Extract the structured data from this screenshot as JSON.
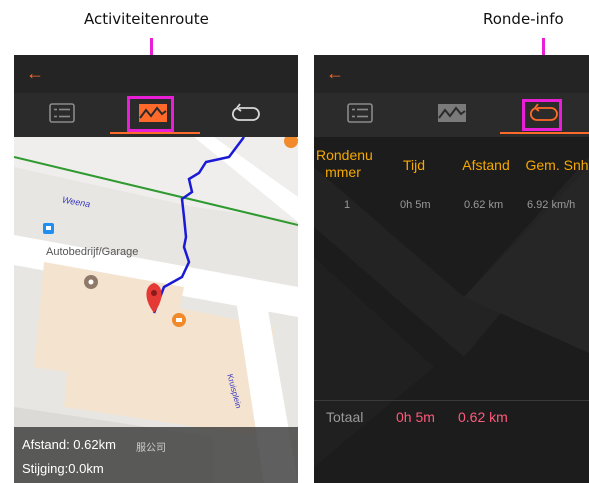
{
  "captions": {
    "left": "Activiteitenroute",
    "right": "Ronde-info"
  },
  "colors": {
    "accent": "#ff6a2a",
    "highlight": "#e81fd6",
    "header_text": "#f5a800",
    "total_text": "#ff5a7a",
    "route": "#1a1ad6"
  },
  "left_screen": {
    "back_icon": "arrow-left-icon",
    "tabs": [
      {
        "icon": "list-icon",
        "active": false
      },
      {
        "icon": "route-map-icon",
        "active": true
      },
      {
        "icon": "lap-loop-icon",
        "active": false
      }
    ],
    "map": {
      "street_label": "Weena",
      "poi_label": "Autobedrijf/Garage",
      "side_street_label": "Kruisplein",
      "overlay_suffix": "服公司",
      "distance": "Afstand: 0.62km",
      "elevation": "Stijging:0.0km"
    }
  },
  "right_screen": {
    "back_icon": "arrow-left-icon",
    "tabs": [
      {
        "icon": "list-icon",
        "active": false
      },
      {
        "icon": "route-map-icon",
        "active": false
      },
      {
        "icon": "lap-loop-icon",
        "active": true
      }
    ],
    "table": {
      "headers": [
        "Rondenu mmer",
        "Tijd",
        "Afstand",
        "Gem. Snh"
      ],
      "rows": [
        [
          "1",
          "0h 5m",
          "0.62 km",
          "6.92 km/h"
        ]
      ],
      "total_label": "Totaal",
      "total_time": "0h 5m",
      "total_distance": "0.62 km"
    }
  }
}
